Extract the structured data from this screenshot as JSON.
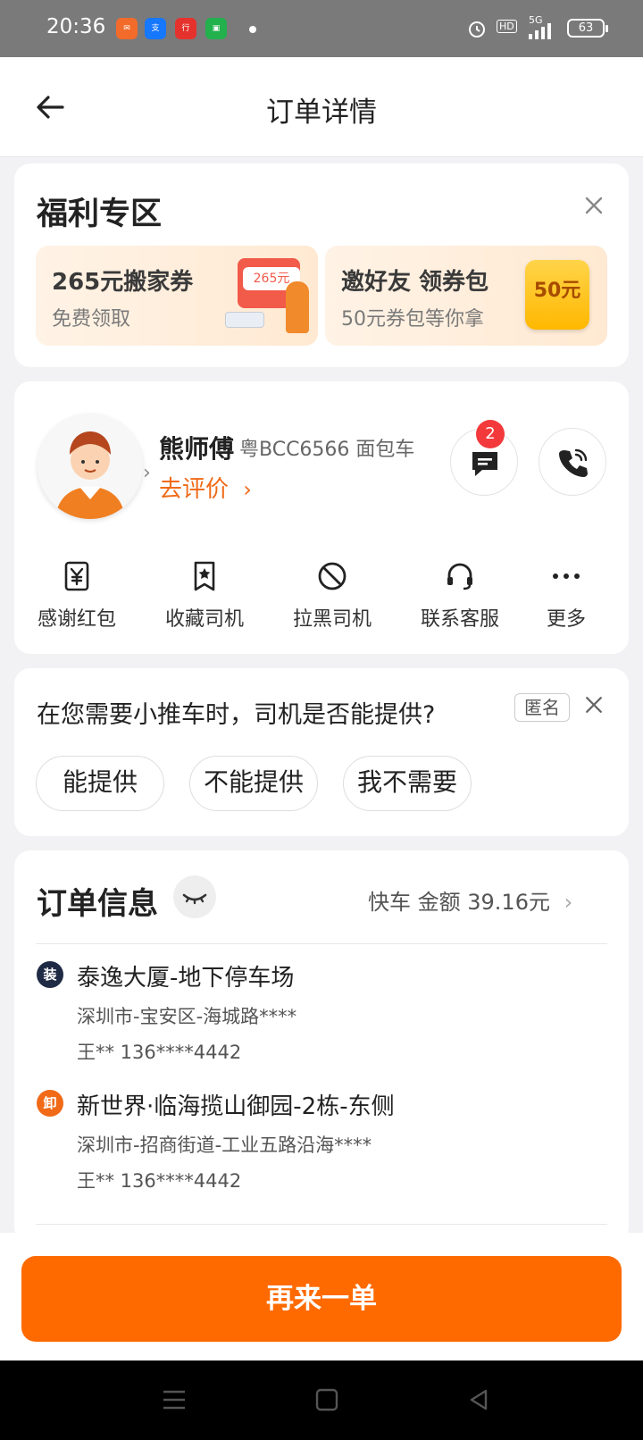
{
  "status_bar": {
    "time": "20:36",
    "network": "5G",
    "hd": "HD",
    "battery": "63"
  },
  "header": {
    "title": "订单详情"
  },
  "benefits": {
    "title": "福利专区",
    "promos": [
      {
        "title": "265元搬家券",
        "subtitle": "免费领取",
        "badge": "265元"
      },
      {
        "title": "邀好友 领券包",
        "subtitle": "50元券包等你拿",
        "badge": "50元"
      }
    ]
  },
  "driver": {
    "name": "熊师傅",
    "plate_vehicle": "粤BCC6566 面包车",
    "rate_label": "去评价",
    "unread_messages": "2",
    "actions": [
      {
        "label": "感谢红包",
        "icon": "red-envelope-icon"
      },
      {
        "label": "收藏司机",
        "icon": "bookmark-star-icon"
      },
      {
        "label": "拉黑司机",
        "icon": "block-icon"
      },
      {
        "label": "联系客服",
        "icon": "headset-icon"
      },
      {
        "label": "更多",
        "icon": "more-dots-icon"
      }
    ]
  },
  "survey": {
    "question": "在您需要小推车时，司机是否能提供?",
    "anonymous_label": "匿名",
    "options": [
      "能提供",
      "不能提供",
      "我不需要"
    ]
  },
  "order_info": {
    "title": "订单信息",
    "summary": "快车 金额 39.16元",
    "stops": [
      {
        "tag": "装",
        "name": "泰逸大厦-地下停车场",
        "address": "深圳市-宝安区-海城路****",
        "contact": "王** 136****4442",
        "color": "#1f2a44"
      },
      {
        "tag": "卸",
        "name": "新世界·临海揽山御园-2栋-东侧",
        "address": "深圳市-招商街道-工业五路沿海****",
        "contact": "王** 136****4442",
        "color": "#f06a18"
      }
    ]
  },
  "footer": {
    "reorder_label": "再来一单"
  },
  "colors": {
    "accent": "#ff6a00",
    "link": "#f06a18",
    "badge": "#f3393b"
  }
}
